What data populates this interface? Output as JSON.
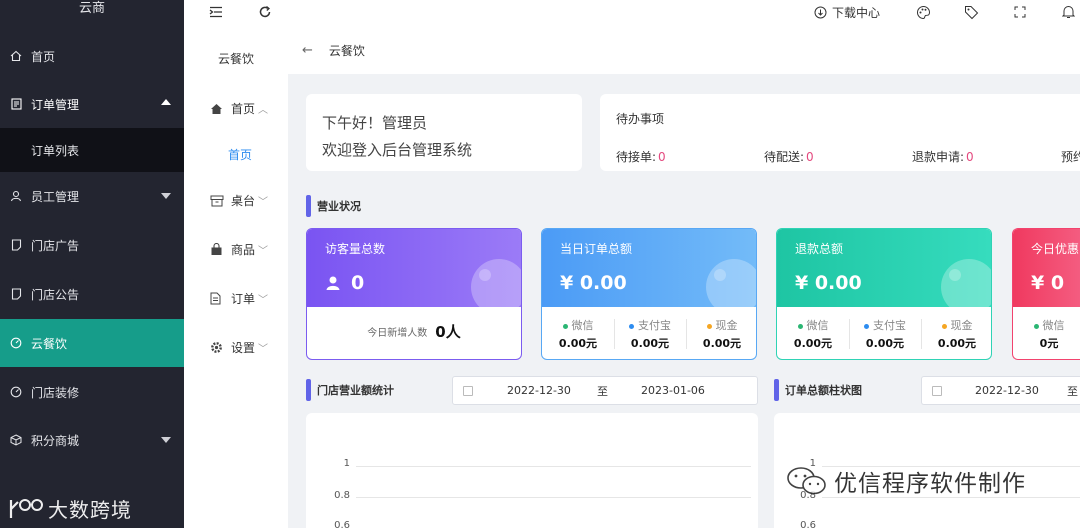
{
  "brand": "云商",
  "sidebar": {
    "items": [
      {
        "label": "首页",
        "icon": "home-icon"
      },
      {
        "label": "订单管理",
        "icon": "document-icon"
      },
      {
        "label": "订单列表"
      },
      {
        "label": "员工管理",
        "icon": "user-icon"
      },
      {
        "label": "门店广告",
        "icon": "tag-icon"
      },
      {
        "label": "门店公告",
        "icon": "tag-icon"
      },
      {
        "label": "云餐饮",
        "icon": "dashboard-icon"
      },
      {
        "label": "门店装修",
        "icon": "dashboard-icon"
      },
      {
        "label": "积分商城",
        "icon": "cube-icon"
      }
    ]
  },
  "topbar": {
    "download_label": "下载中心"
  },
  "submenu": {
    "title": "云餐饮",
    "items": [
      {
        "label": "首页",
        "icon": "house-icon"
      },
      {
        "label": "首页"
      },
      {
        "label": "桌台",
        "icon": "box-icon"
      },
      {
        "label": "商品",
        "icon": "bag-icon"
      },
      {
        "label": "订单",
        "icon": "file-icon"
      },
      {
        "label": "设置",
        "icon": "gear-icon"
      }
    ]
  },
  "breadcrumb": {
    "current": "云餐饮"
  },
  "greeting": {
    "line1": "下午好！管理员",
    "line2": "欢迎登入后台管理系统"
  },
  "todo": {
    "title": "待办事项",
    "items": [
      {
        "label": "待接单:",
        "value": "0"
      },
      {
        "label": "待配送:",
        "value": "0"
      },
      {
        "label": "退款申请:",
        "value": "0"
      },
      {
        "label": "预约"
      }
    ]
  },
  "business": {
    "title": "营业状况",
    "visitors": {
      "label": "访客量总数",
      "value": "0",
      "sub_label": "今日新增人数",
      "sub_value": "0人"
    },
    "orders": {
      "label": "当日订单总额",
      "value": "¥ 0.00",
      "breakdown": [
        {
          "name": "微信",
          "value": "0.00元"
        },
        {
          "name": "支付宝",
          "value": "0.00元"
        },
        {
          "name": "现金",
          "value": "0.00元"
        }
      ]
    },
    "refunds": {
      "label": "退款总额",
      "value": "¥ 0.00",
      "breakdown": [
        {
          "name": "微信",
          "value": "0.00元"
        },
        {
          "name": "支付宝",
          "value": "0.00元"
        },
        {
          "name": "现金",
          "value": "0.00元"
        }
      ]
    },
    "discount": {
      "label": "今日优惠",
      "value": "¥ 0",
      "breakdown": [
        {
          "name": "微信",
          "value": "0元"
        }
      ]
    }
  },
  "revenue_chart": {
    "title": "门店营业额统计",
    "start": "2022-12-30",
    "to": "至",
    "end": "2023-01-06",
    "yticks": [
      "1",
      "0.8",
      "0.6"
    ]
  },
  "order_chart": {
    "title": "订单总额柱状图",
    "start": "2022-12-30",
    "to": "至",
    "yticks": [
      "1",
      "0.8",
      "0.6"
    ]
  },
  "watermarks": {
    "left": "大数跨境",
    "right": "优信程序软件制作"
  },
  "colors": {
    "sidebar_bg": "#232530",
    "active": "#169d8a",
    "accent": "#6164e8",
    "pink": "#e4497f"
  }
}
